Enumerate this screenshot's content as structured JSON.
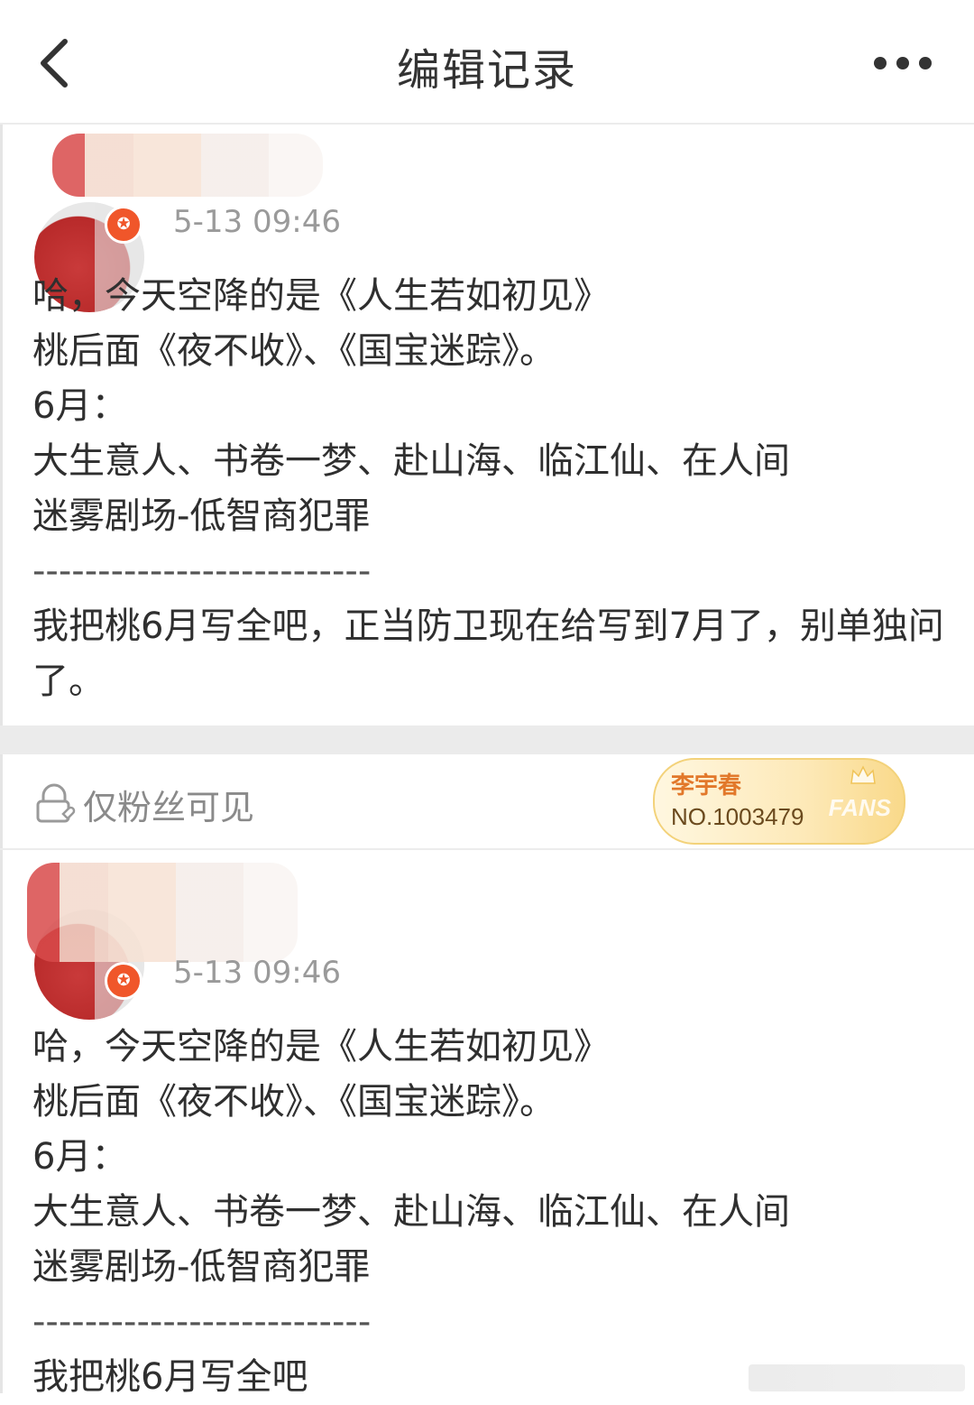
{
  "header": {
    "title": "编辑记录"
  },
  "icons": {
    "back": "chevron-left-icon",
    "more": "ellipsis-icon",
    "lock": "lock-heart-icon",
    "verified": "verified-star-icon"
  },
  "colors": {
    "badge_orange": "#f0562a",
    "fans_badge_gold": "#f9d98a",
    "fans_badge_name": "#e2782a"
  },
  "posts": [
    {
      "timestamp": "5-13 09:46",
      "lines": [
        "哈，今天空降的是《人生若如初见》",
        "桃后面《夜不收》、《国宝迷踪》。",
        "6月：",
        "大生意人、书卷一梦、赴山海、临江仙、在人间",
        "迷雾剧场-低智商犯罪",
        "--------------------------",
        "我把桃6月写全吧，正当防卫现在给写到7月了，别单独问了。"
      ]
    },
    {
      "timestamp": "5-13 09:46",
      "lines": [
        "哈，今天空降的是《人生若如初见》",
        "桃后面《夜不收》、《国宝迷踪》。",
        "6月：",
        "大生意人、书卷一梦、赴山海、临江仙、在人间",
        "迷雾剧场-低智商犯罪",
        "--------------------------",
        "我把桃6月写全吧"
      ]
    }
  ],
  "fans_row": {
    "visibility_label": "仅粉丝可见",
    "badge_name": "李宇春",
    "badge_number": "NO.1003479",
    "badge_mark": "FANS"
  }
}
